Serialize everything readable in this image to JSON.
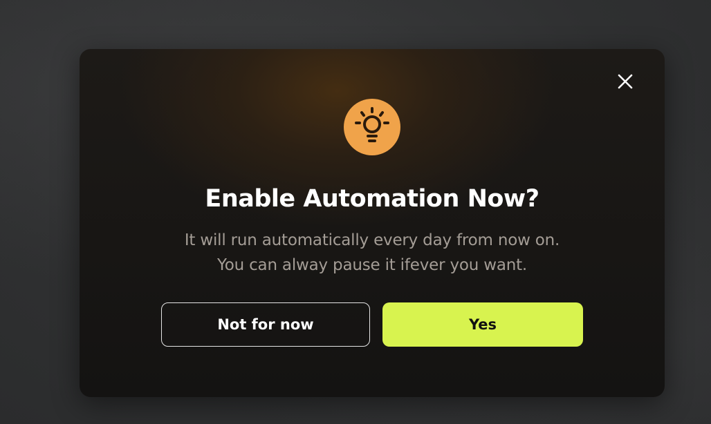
{
  "dialog": {
    "title": "Enable Automation Now?",
    "description_line1": "It will run automatically every day from now on.",
    "description_line2": "You can alway pause it ifever you want.",
    "icon": "lightbulb-icon",
    "close_icon": "close-icon",
    "buttons": {
      "secondary_label": "Not for now",
      "primary_label": "Yes"
    }
  },
  "colors": {
    "accent_primary": "#d8f34f",
    "icon_background": "#f0a34a",
    "title": "#ffffff",
    "description": "#a49d96"
  }
}
